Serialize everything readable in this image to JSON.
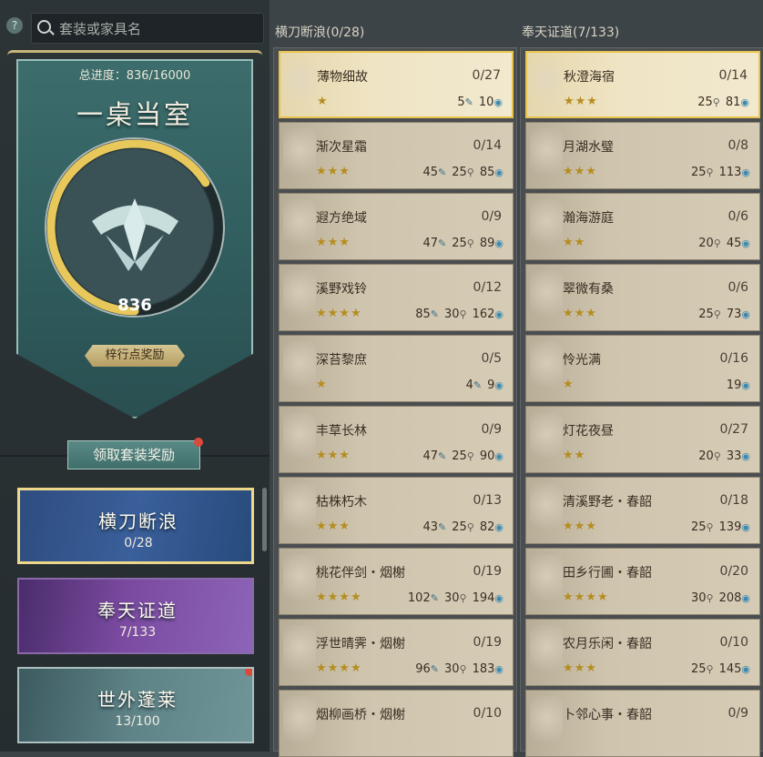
{
  "search": {
    "placeholder": "套装或家具名"
  },
  "help_icon": "question-icon",
  "banner": {
    "progress": "总进度：836/16000",
    "title": "一桌当室",
    "ring_value": "836",
    "ring_fraction": 0.66,
    "reward_tag": "梓行点奖励"
  },
  "claim_button": "领取套装奖励",
  "categories": [
    {
      "title": "横刀断浪",
      "count": "0/28"
    },
    {
      "title": "奉天证道",
      "count": "7/133"
    },
    {
      "title": "世外蓬莱",
      "count": "13/100"
    }
  ],
  "col1": {
    "header": "横刀断浪(0/28)",
    "rows": [
      {
        "name": "薄物细故",
        "count": "0/27",
        "stars": "★",
        "tool": "5",
        "shirt": "",
        "feather": "10",
        "selected": true
      },
      {
        "name": "渐次星霜",
        "count": "0/14",
        "stars": "★★★",
        "tool": "45",
        "shirt": "25",
        "feather": "85"
      },
      {
        "name": "遐方绝域",
        "count": "0/9",
        "stars": "★★★",
        "tool": "47",
        "shirt": "25",
        "feather": "89"
      },
      {
        "name": "溪野戏铃",
        "count": "0/12",
        "stars": "★★★★",
        "tool": "85",
        "shirt": "30",
        "feather": "162"
      },
      {
        "name": "深苔黎庶",
        "count": "0/5",
        "stars": "★",
        "tool": "4",
        "shirt": "",
        "feather": "9"
      },
      {
        "name": "丰草长林",
        "count": "0/9",
        "stars": "★★★",
        "tool": "47",
        "shirt": "25",
        "feather": "90"
      },
      {
        "name": "枯株朽木",
        "count": "0/13",
        "stars": "★★★",
        "tool": "43",
        "shirt": "25",
        "feather": "82"
      },
      {
        "name": "桃花伴剑・烟榭",
        "count": "0/19",
        "stars": "★★★★",
        "tool": "102",
        "shirt": "30",
        "feather": "194"
      },
      {
        "name": "浮世晴霁・烟榭",
        "count": "0/19",
        "stars": "★★★★",
        "tool": "96",
        "shirt": "30",
        "feather": "183"
      },
      {
        "name": "烟柳画桥・烟榭",
        "count": "0/10",
        "stars": "",
        "tool": "",
        "shirt": "",
        "feather": ""
      }
    ]
  },
  "col2": {
    "header": "奉天证道(7/133)",
    "rows": [
      {
        "name": "秋澄海宿",
        "count": "0/14",
        "stars": "★★★",
        "tool": "",
        "shirt": "25",
        "feather": "81",
        "selected": true
      },
      {
        "name": "月湖水璧",
        "count": "0/8",
        "stars": "★★★",
        "tool": "",
        "shirt": "25",
        "feather": "113"
      },
      {
        "name": "瀚海游庭",
        "count": "0/6",
        "stars": "★★",
        "tool": "",
        "shirt": "20",
        "feather": "45"
      },
      {
        "name": "翠微有桑",
        "count": "0/6",
        "stars": "★★★",
        "tool": "",
        "shirt": "25",
        "feather": "73"
      },
      {
        "name": "怜光满",
        "count": "0/16",
        "stars": "★",
        "tool": "",
        "shirt": "",
        "feather": "19"
      },
      {
        "name": "灯花夜昼",
        "count": "0/27",
        "stars": "★★",
        "tool": "",
        "shirt": "20",
        "feather": "33"
      },
      {
        "name": "清溪野老・春韶",
        "count": "0/18",
        "stars": "★★★",
        "tool": "",
        "shirt": "25",
        "feather": "139"
      },
      {
        "name": "田乡行圃・春韶",
        "count": "0/20",
        "stars": "★★★★",
        "tool": "",
        "shirt": "30",
        "feather": "208"
      },
      {
        "name": "农月乐闲・春韶",
        "count": "0/10",
        "stars": "★★★",
        "tool": "",
        "shirt": "25",
        "feather": "145"
      },
      {
        "name": "卜邻心事・春韶",
        "count": "0/9",
        "stars": "",
        "tool": "",
        "shirt": "",
        "feather": ""
      }
    ]
  }
}
